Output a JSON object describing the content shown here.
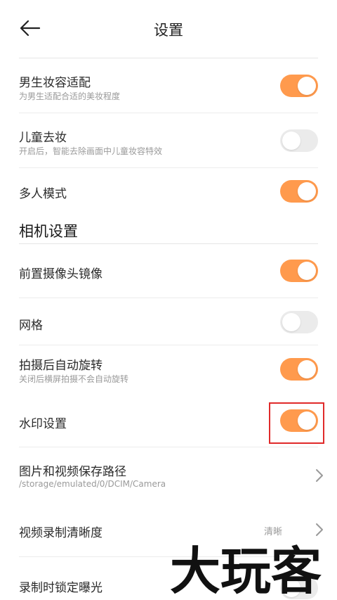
{
  "header": {
    "title": "设置",
    "back_icon": "back-arrow-icon"
  },
  "settings": [
    {
      "label": "男生妆容适配",
      "sub": "为男生适配合适的美妆程度",
      "toggle": "on"
    },
    {
      "label": "儿童去妆",
      "sub": "开启后，智能去除画面中儿童妆容特效",
      "toggle": "off"
    },
    {
      "label": "多人模式",
      "toggle": "on"
    }
  ],
  "camera_section": {
    "title": "相机设置"
  },
  "camera_settings": [
    {
      "label": "前置摄像头镜像",
      "toggle": "on"
    },
    {
      "label": "网格",
      "toggle": "off"
    },
    {
      "label": "拍摄后自动旋转",
      "sub": "关闭后横屏拍摄不会自动旋转",
      "toggle": "on"
    },
    {
      "label": "水印设置",
      "toggle": "on",
      "highlighted": true
    },
    {
      "label": "图片和视频保存路径",
      "sub": "/storage/emulated/0/DCIM/Camera",
      "chevron": "chevron-right-icon"
    },
    {
      "label": "视频录制清晰度",
      "value": "清晰",
      "chevron": "chevron-right-icon"
    },
    {
      "label": "录制时锁定曝光"
    }
  ],
  "watermark": {
    "text": "大玩客"
  },
  "colors": {
    "accent": "#ff9a4d",
    "toggle_off": "#ebebeb",
    "highlight": "#e02a2a"
  }
}
